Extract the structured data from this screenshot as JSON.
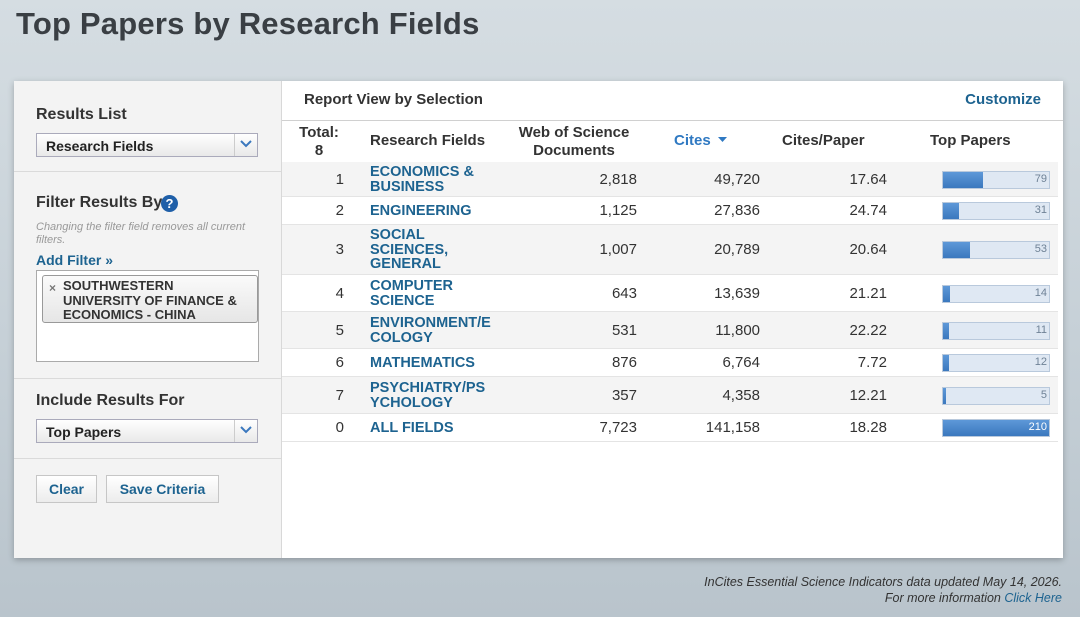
{
  "page": {
    "title": "Top Papers by Research Fields"
  },
  "sidebar": {
    "results_list_label": "Results List",
    "results_list_value": "Research Fields",
    "filter_label": "Filter Results By",
    "help_glyph": "?",
    "filter_note": "Changing the filter field removes all current filters.",
    "add_filter": "Add Filter »",
    "filter_chip": "SOUTHWESTERN UNIVERSITY OF FINANCE & ECONOMICS - CHINA",
    "chip_remove": "×",
    "include_label": "Include Results For",
    "include_value": "Top Papers",
    "clear_button": "Clear",
    "save_button": "Save Criteria"
  },
  "main": {
    "report_title": "Report View by Selection",
    "customize": "Customize",
    "headers": {
      "total": "Total: 8",
      "field": "Research Fields",
      "docs": "Web of Science Documents",
      "cites": "Cites",
      "cpp": "Cites/Paper",
      "top": "Top Papers"
    },
    "rows": [
      {
        "rank": "1",
        "field": "ECONOMICS & BUSINESS",
        "docs": "2,818",
        "cites": "49,720",
        "cpp": "17.64",
        "top": "79",
        "top_frac": 0.376
      },
      {
        "rank": "2",
        "field": "ENGINEERING",
        "docs": "1,125",
        "cites": "27,836",
        "cpp": "24.74",
        "top": "31",
        "top_frac": 0.148
      },
      {
        "rank": "3",
        "field": "SOCIAL SCIENCES, GENERAL",
        "docs": "1,007",
        "cites": "20,789",
        "cpp": "20.64",
        "top": "53",
        "top_frac": 0.252
      },
      {
        "rank": "4",
        "field": "COMPUTER SCIENCE",
        "docs": "643",
        "cites": "13,639",
        "cpp": "21.21",
        "top": "14",
        "top_frac": 0.067
      },
      {
        "rank": "5",
        "field": "ENVIRONMENT/E COLOGY",
        "docs": "531",
        "cites": "11,800",
        "cpp": "22.22",
        "top": "11",
        "top_frac": 0.052
      },
      {
        "rank": "6",
        "field": "MATHEMATICS",
        "docs": "876",
        "cites": "6,764",
        "cpp": "7.72",
        "top": "12",
        "top_frac": 0.057
      },
      {
        "rank": "7",
        "field": "PSYCHIATRY/PS YCHOLOGY",
        "docs": "357",
        "cites": "4,358",
        "cpp": "12.21",
        "top": "5",
        "top_frac": 0.024
      },
      {
        "rank": "0",
        "field": "ALL FIELDS",
        "docs": "7,723",
        "cites": "141,158",
        "cpp": "18.28",
        "top": "210",
        "top_frac": 1.0
      }
    ]
  },
  "footer": {
    "line1": "InCites Essential Science Indicators data updated May 14, 2026.",
    "line2_prefix": "For more information ",
    "line2_link": "Click Here"
  }
}
